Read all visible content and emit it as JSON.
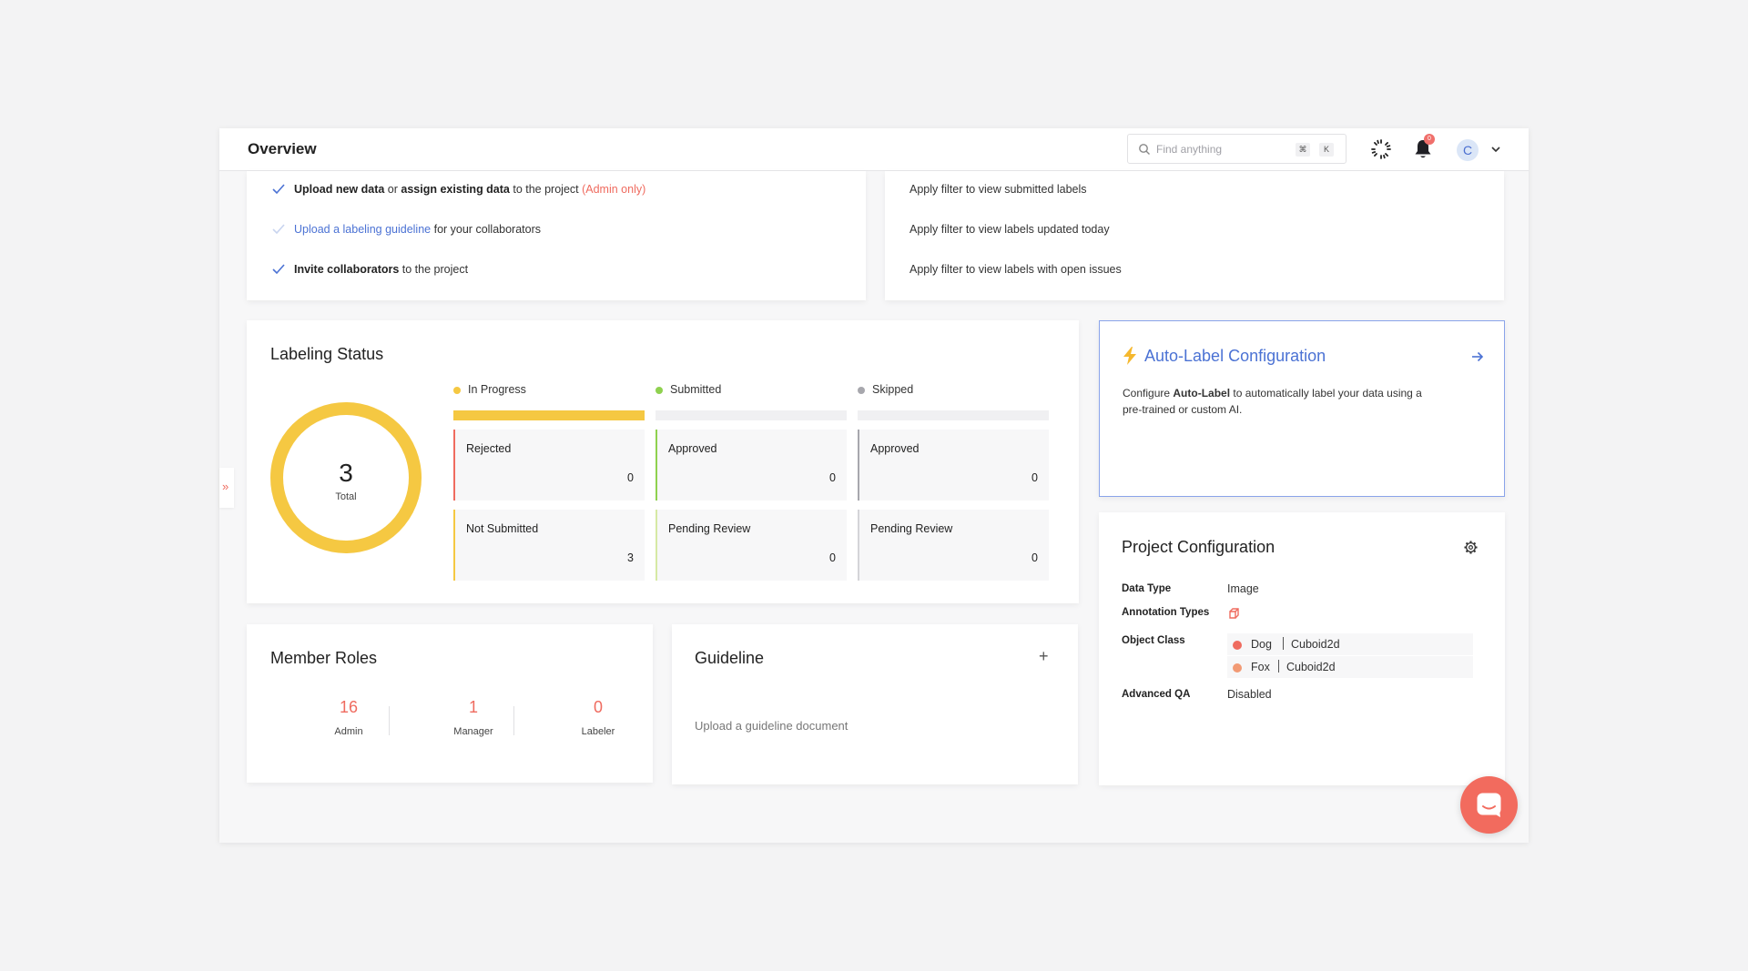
{
  "header": {
    "title": "Overview",
    "search_placeholder": "Find anything",
    "kbd_cmd": "⌘",
    "kbd_k": "K",
    "notification_count": "0",
    "avatar_initial": "C"
  },
  "checklist": {
    "items": [
      {
        "checked": true,
        "p1": "Upload new data",
        "p2": " or ",
        "p3": "assign existing data",
        "p4": " to the project ",
        "p5": "(Admin only)"
      },
      {
        "checked": false,
        "link": "Upload a labeling guideline",
        "rest": " for your collaborators"
      },
      {
        "checked": true,
        "bold": "Invite collaborators",
        "rest": " to the project"
      }
    ]
  },
  "filters": {
    "items": [
      "Apply filter to view submitted labels",
      "Apply filter to view labels updated today",
      "Apply filter to view labels with open issues"
    ]
  },
  "labeling_status": {
    "title": "Labeling Status",
    "total": "3",
    "total_label": "Total",
    "columns": [
      {
        "legend": "In Progress",
        "color": "#f5c842",
        "fill": 1.0,
        "stats": [
          {
            "label": "Rejected",
            "value": "0",
            "color": "#ef6b5f"
          },
          {
            "label": "Not Submitted",
            "value": "3",
            "color": "#f5c842"
          }
        ]
      },
      {
        "legend": "Submitted",
        "color": "#8fd14f",
        "fill": 0.0,
        "stats": [
          {
            "label": "Approved",
            "value": "0",
            "color": "#8fd14f"
          },
          {
            "label": "Pending Review",
            "value": "0",
            "color": "#d6e9a4"
          }
        ]
      },
      {
        "legend": "Skipped",
        "color": "#a7a7ad",
        "fill": 0.0,
        "stats": [
          {
            "label": "Approved",
            "value": "0",
            "color": "#a7a7ad"
          },
          {
            "label": "Pending Review",
            "value": "0",
            "color": "#d4d4d8"
          }
        ]
      }
    ]
  },
  "auto_label": {
    "title": "Auto-Label Configuration",
    "desc_pre": "Configure ",
    "desc_bold": "Auto-Label",
    "desc_line1_post": " to automatically label your data using a",
    "desc_line2": "pre-trained or custom AI."
  },
  "project_config": {
    "title": "Project Configuration",
    "data_type_label": "Data Type",
    "data_type": "Image",
    "annotation_types_label": "Annotation Types",
    "object_class_label": "Object Class",
    "object_classes": [
      {
        "name": "Dog",
        "type": "Cuboid2d",
        "color": "#ef6b5f"
      },
      {
        "name": "Fox",
        "type": "Cuboid2d",
        "color": "#f29a74"
      }
    ],
    "advanced_qa_label": "Advanced QA",
    "advanced_qa": "Disabled"
  },
  "member_roles": {
    "title": "Member Roles",
    "roles": [
      {
        "count": "16",
        "label": "Admin"
      },
      {
        "count": "1",
        "label": "Manager"
      },
      {
        "count": "0",
        "label": "Labeler"
      }
    ]
  },
  "guideline": {
    "title": "Guideline",
    "add": "+",
    "empty": "Upload a guideline document"
  },
  "expander_glyph": "»",
  "colors": {
    "accent": "#4b72d4",
    "brand": "#ef6b5f",
    "progress": "#f5c842"
  }
}
